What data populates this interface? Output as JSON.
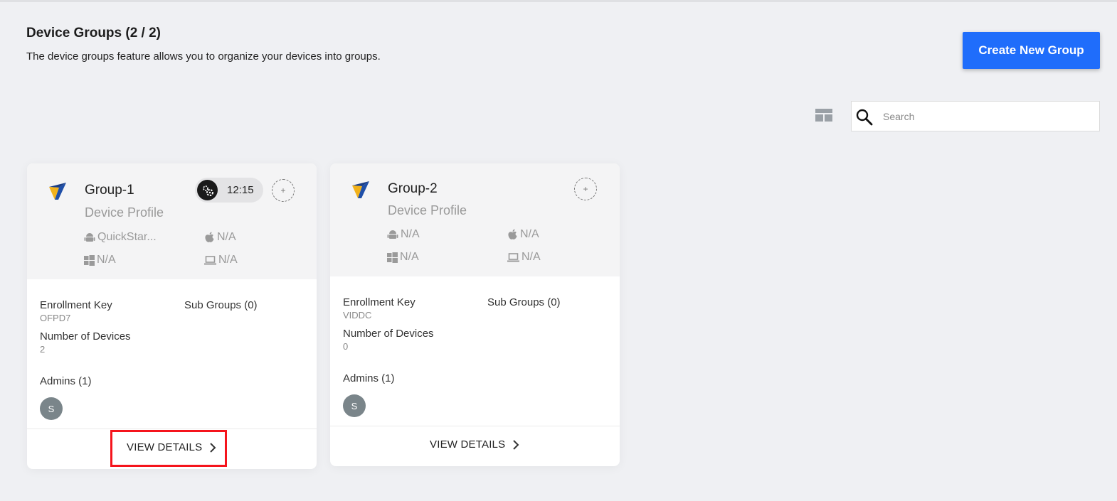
{
  "header": {
    "title": "Device Groups (2 / 2)",
    "subtitle": "The device groups feature allows you to organize your devices into groups.",
    "create_button": "Create New Group"
  },
  "search": {
    "placeholder": "Search",
    "value": ""
  },
  "groups": [
    {
      "name": "Group-1",
      "profile_label": "Device Profile",
      "schedule_time": "12:15",
      "android": "QuickStar...",
      "apple": "N/A",
      "windows": "N/A",
      "laptop": "N/A",
      "enrollment_key_label": "Enrollment Key",
      "enrollment_key": "OFPD7",
      "sub_groups_label": "Sub Groups (0)",
      "devices_label": "Number of Devices",
      "devices_count": "2",
      "admins_label": "Admins (1)",
      "admin_initial": "S",
      "view_details": "VIEW DETAILS",
      "add_symbol": "+"
    },
    {
      "name": "Group-2",
      "profile_label": "Device Profile",
      "android": "N/A",
      "apple": "N/A",
      "windows": "N/A",
      "laptop": "N/A",
      "enrollment_key_label": "Enrollment Key",
      "enrollment_key": "VIDDC",
      "sub_groups_label": "Sub Groups (0)",
      "devices_label": "Number of Devices",
      "devices_count": "0",
      "admins_label": "Admins (1)",
      "admin_initial": "S",
      "view_details": "VIEW DETAILS",
      "add_symbol": "+"
    }
  ],
  "colors": {
    "accent": "#1f6dfb",
    "highlight": "#f5141c",
    "background": "#eff0f3"
  },
  "icons": [
    "logo-icon",
    "gear-icon",
    "android-icon",
    "apple-icon",
    "windows-icon",
    "laptop-icon",
    "search-icon",
    "grid-view-icon",
    "chevron-right-icon"
  ]
}
